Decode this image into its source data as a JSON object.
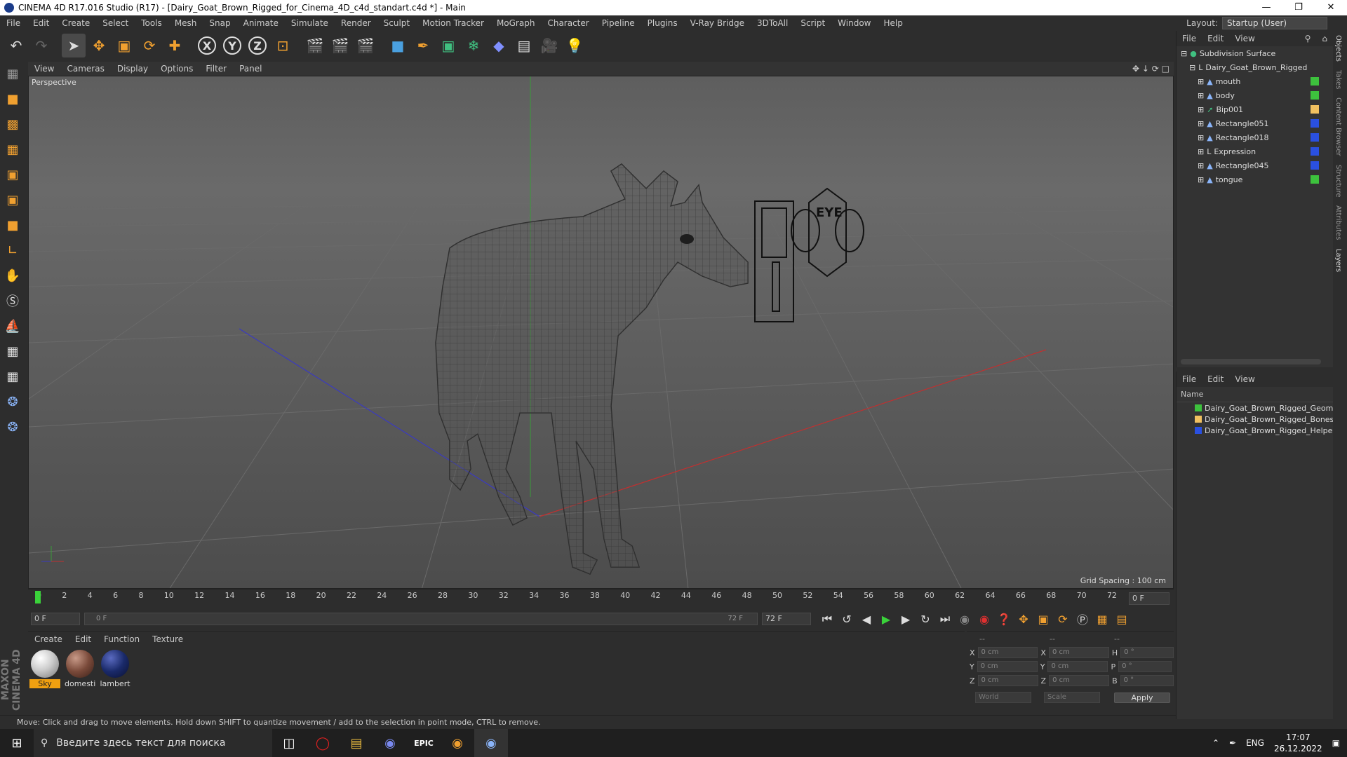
{
  "window": {
    "title": "CINEMA 4D R17.016 Studio (R17) - [Dairy_Goat_Brown_Rigged_for_Cinema_4D_c4d_standart.c4d *] - Main"
  },
  "menu": [
    "File",
    "Edit",
    "Create",
    "Select",
    "Tools",
    "Mesh",
    "Snap",
    "Animate",
    "Simulate",
    "Render",
    "Sculpt",
    "Motion Tracker",
    "MoGraph",
    "Character",
    "Pipeline",
    "Plugins",
    "V-Ray Bridge",
    "3DToAll",
    "Script",
    "Window",
    "Help"
  ],
  "layout": {
    "label": "Layout:",
    "value": "Startup (User)"
  },
  "viewport": {
    "menu": [
      "View",
      "Cameras",
      "Display",
      "Options",
      "Filter",
      "Panel"
    ],
    "label": "Perspective",
    "grid_spacing": "Grid Spacing : 100 cm",
    "overlay_text": "EYE"
  },
  "timeline": {
    "ticks": [
      "0",
      "2",
      "4",
      "6",
      "8",
      "10",
      "12",
      "14",
      "16",
      "18",
      "20",
      "22",
      "24",
      "26",
      "28",
      "30",
      "32",
      "34",
      "36",
      "38",
      "40",
      "42",
      "44",
      "46",
      "48",
      "50",
      "52",
      "54",
      "56",
      "58",
      "60",
      "62",
      "64",
      "66",
      "68",
      "70",
      "72"
    ],
    "current_frame": "0 F",
    "start": "0 F",
    "range_start": "0 F",
    "range_end": "72 F",
    "end": "72 F"
  },
  "materials": {
    "menu": [
      "Create",
      "Edit",
      "Function",
      "Texture"
    ],
    "items": [
      {
        "name": "Sky",
        "selected": true,
        "color": "#e8e8e8"
      },
      {
        "name": "domesti",
        "selected": false,
        "color": "#7a4a3a"
      },
      {
        "name": "lambert",
        "selected": false,
        "color": "#1a2a6a"
      }
    ]
  },
  "coords": {
    "header": [
      "--",
      "--",
      "--"
    ],
    "rows": [
      {
        "a": "X",
        "av": "0 cm",
        "b": "X",
        "bv": "0 cm",
        "c": "H",
        "cv": "0 °"
      },
      {
        "a": "Y",
        "av": "0 cm",
        "b": "Y",
        "bv": "0 cm",
        "c": "P",
        "cv": "0 °"
      },
      {
        "a": "Z",
        "av": "0 cm",
        "b": "Z",
        "bv": "0 cm",
        "c": "B",
        "cv": "0 °"
      }
    ],
    "world": "World",
    "scale": "Scale",
    "apply": "Apply"
  },
  "status": "Move: Click and drag to move elements. Hold down SHIFT to quantize movement / add to the selection in point mode, CTRL to remove.",
  "objects": {
    "menu": [
      "File",
      "Edit",
      "View"
    ],
    "items": [
      {
        "name": "Subdivision Surface",
        "indent": 0,
        "tag": ""
      },
      {
        "name": "Dairy_Goat_Brown_Rigged",
        "indent": 1,
        "tag": ""
      },
      {
        "name": "mouth",
        "indent": 2,
        "tag": "#3dc23d"
      },
      {
        "name": "body",
        "indent": 2,
        "tag": "#3dc23d"
      },
      {
        "name": "Bip001",
        "indent": 2,
        "tag": "#f0c060"
      },
      {
        "name": "Rectangle051",
        "indent": 2,
        "tag": "#2a50e0"
      },
      {
        "name": "Rectangle018",
        "indent": 2,
        "tag": "#2a50e0"
      },
      {
        "name": "Expression",
        "indent": 2,
        "tag": "#2a50e0"
      },
      {
        "name": "Rectangle045",
        "indent": 2,
        "tag": "#2a50e0"
      },
      {
        "name": "tongue",
        "indent": 2,
        "tag": "#3dc23d"
      }
    ]
  },
  "layers": {
    "menu": [
      "File",
      "Edit",
      "View"
    ],
    "header": "Name",
    "items": [
      {
        "name": "Dairy_Goat_Brown_Rigged_Geome",
        "color": "#3dc23d"
      },
      {
        "name": "Dairy_Goat_Brown_Rigged_Bones",
        "color": "#f0c060"
      },
      {
        "name": "Dairy_Goat_Brown_Rigged_Helper",
        "color": "#2a50e0"
      }
    ]
  },
  "sidetabs": [
    "Objects",
    "Takes",
    "Content Browser",
    "Structure",
    "Attributes",
    "Layers"
  ],
  "taskbar": {
    "search_placeholder": "Введите здесь текст для поиска",
    "lang": "ENG",
    "time": "17:07",
    "date": "26.12.2022"
  }
}
